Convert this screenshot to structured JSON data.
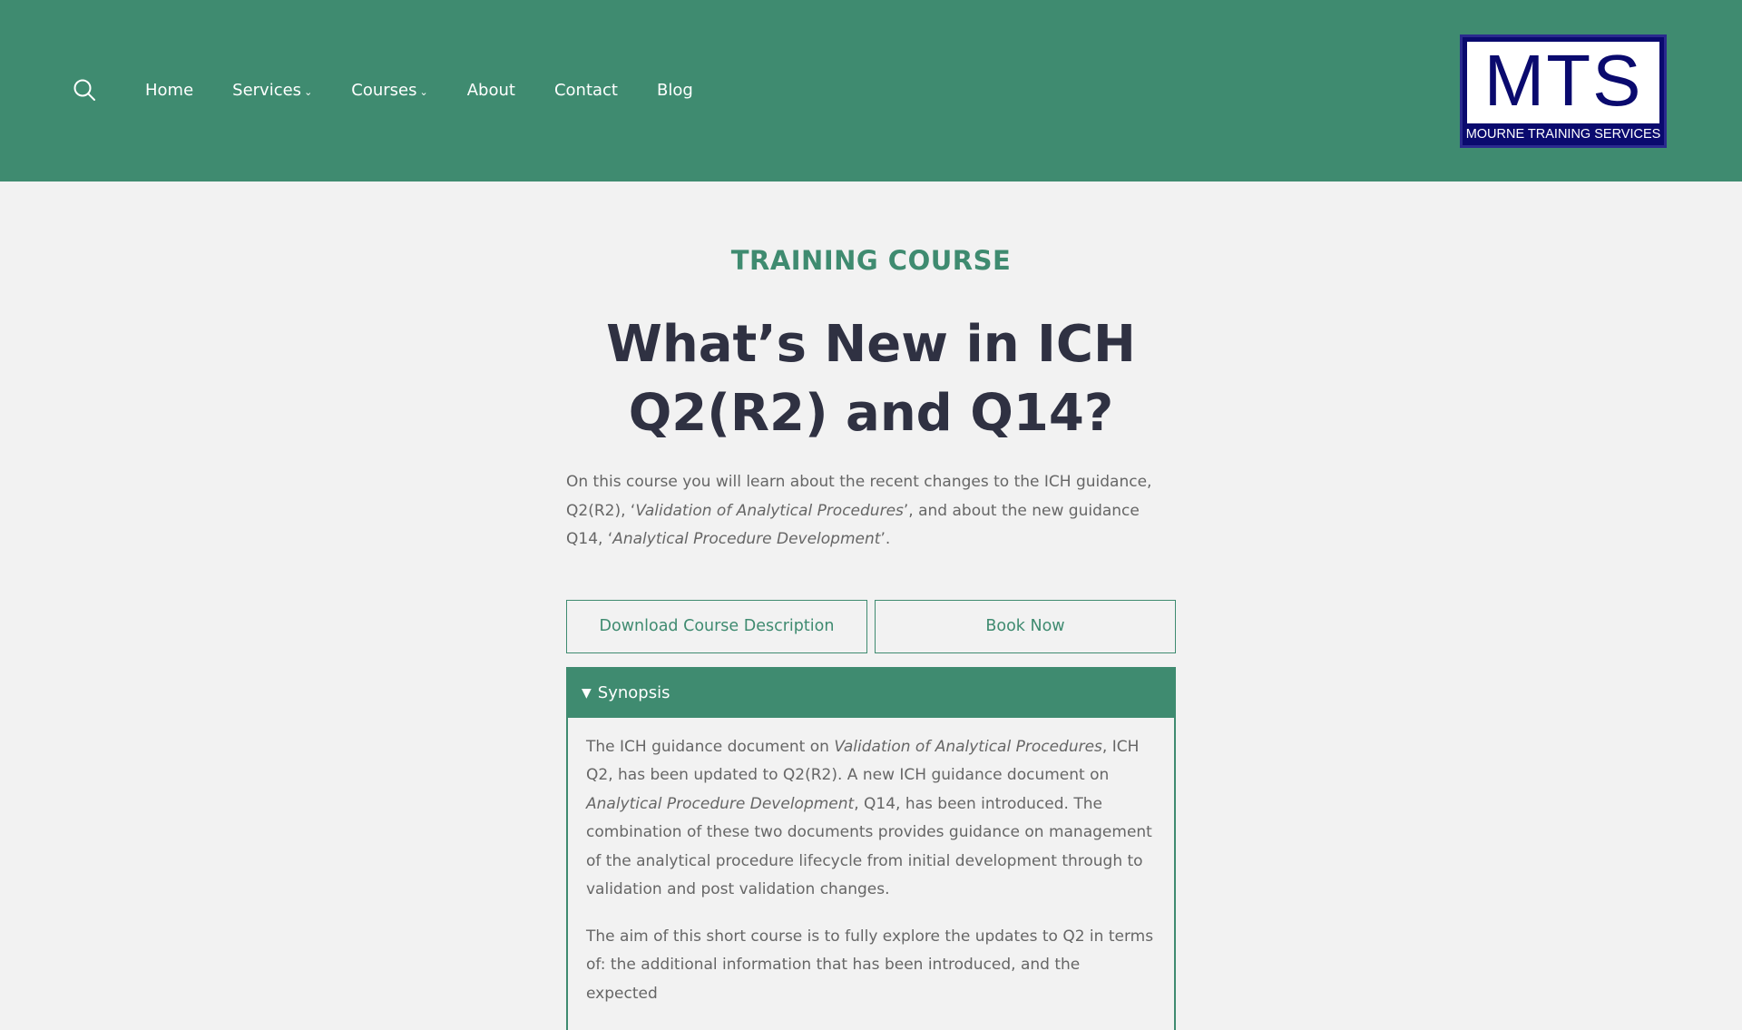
{
  "header": {
    "nav": [
      {
        "label": "Home",
        "dropdown": false
      },
      {
        "label": "Services",
        "dropdown": true
      },
      {
        "label": "Courses",
        "dropdown": true
      },
      {
        "label": "About",
        "dropdown": false
      },
      {
        "label": "Contact",
        "dropdown": false
      },
      {
        "label": "Blog",
        "dropdown": false
      }
    ],
    "search_icon": "search-icon",
    "logo": {
      "text": "MTS",
      "subtitle": "MOURNE TRAINING SERVICES"
    }
  },
  "main": {
    "eyebrow": "TRAINING COURSE",
    "title": "What’s New in ICH Q2(R2) and Q14?",
    "intro": {
      "p1": "On this course you will learn about the recent changes to the ICH guidance, Q2(R2), ‘",
      "p1_em": "Validation of Analytical Procedures",
      "p2": "’, and about the new guidance Q14, ‘",
      "p2_em": "Analytical Procedure Development",
      "p3": "’."
    },
    "buttons": {
      "download": "Download Course Description",
      "book": "Book Now"
    },
    "synopsis": {
      "label": "Synopsis",
      "para1": {
        "a": "The ICH guidance document on ",
        "a_em": "Validation of Analytical Procedures",
        "b": ", ICH Q2, has been updated to Q2(R2). A new ICH guidance document on ",
        "b_em": "Analytical Procedure Development",
        "c": ", Q14, has been introduced. The combination of these two documents provides guidance on management of the analytical procedure lifecycle from initial development through to validation and post validation changes."
      },
      "para2": "The aim of this short course is to fully explore the updates to Q2 in terms of: the additional information that has been introduced, and the expected"
    }
  },
  "colors": {
    "brand_green": "#3f8b70",
    "title_dark": "#2f3142",
    "logo_navy": "#0a0a6e",
    "background": "#f2f2f2"
  }
}
